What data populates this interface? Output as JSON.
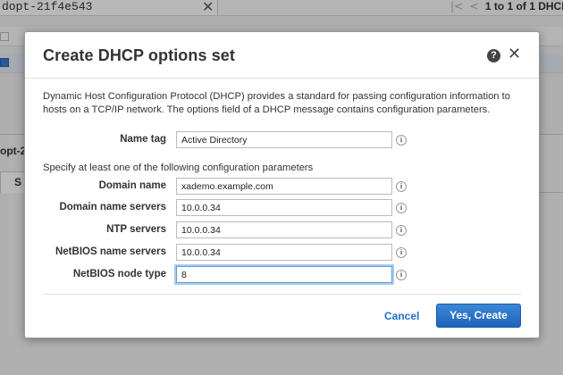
{
  "background": {
    "search_value": "dopt-21f4e543",
    "pager_text": "1 to 1 of 1 DHCP",
    "pager_prev_icon": "first-page-icon",
    "panel_id": "opt-2",
    "tab_label": "S"
  },
  "dialog": {
    "title": "Create DHCP options set",
    "description": "Dynamic Host Configuration Protocol (DHCP) provides a standard for passing configuration information to hosts on a TCP/IP network. The options field of a DHCP message contains configuration parameters.",
    "subheading": "Specify at least one of the following configuration parameters",
    "info_glyph": "i",
    "fields": [
      {
        "label": "Name tag",
        "value": "Active Directory"
      },
      {
        "label": "Domain name",
        "value": "xademo.example.com"
      },
      {
        "label": "Domain name servers",
        "value": "10.0.0.34"
      },
      {
        "label": "NTP servers",
        "value": "10.0.0.34"
      },
      {
        "label": "NetBIOS name servers",
        "value": "10.0.0.34"
      },
      {
        "label": "NetBIOS node type",
        "value": "8"
      }
    ],
    "cancel_label": "Cancel",
    "create_label": "Yes, Create"
  },
  "colors": {
    "primary_button": "#2a74c9",
    "link": "#1f6fc5",
    "focus_ring": "#5b9dd9"
  }
}
